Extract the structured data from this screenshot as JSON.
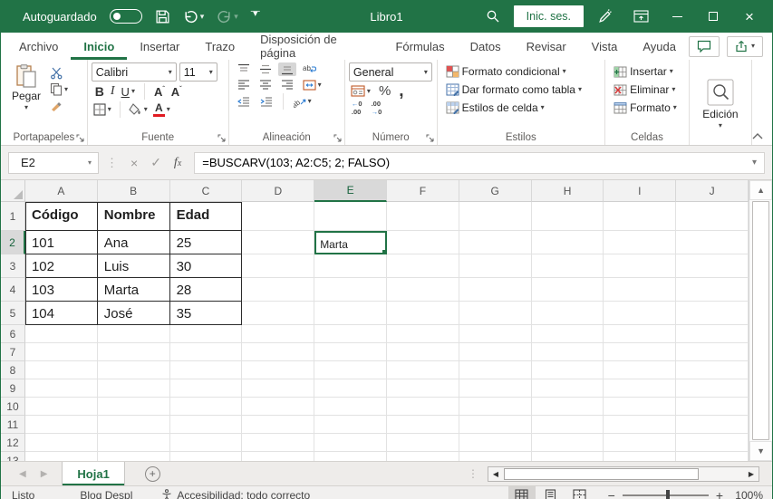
{
  "window": {
    "title": "Libro1",
    "autosave_label": "Autoguardado",
    "signin_label": "Inic. ses."
  },
  "ribbon_tabs": {
    "items": [
      "Archivo",
      "Inicio",
      "Insertar",
      "Trazo",
      "Disposición de página",
      "Fórmulas",
      "Datos",
      "Revisar",
      "Vista",
      "Ayuda"
    ],
    "active": "Inicio"
  },
  "ribbon": {
    "clipboard": {
      "label": "Portapapeles",
      "paste": "Pegar"
    },
    "font": {
      "label": "Fuente",
      "family": "Calibri",
      "size": "11"
    },
    "alignment": {
      "label": "Alineación"
    },
    "number": {
      "label": "Número",
      "format": "General"
    },
    "styles": {
      "label": "Estilos",
      "conditional": "Formato condicional",
      "format_table": "Dar formato como tabla",
      "cell_styles": "Estilos de celda"
    },
    "cells": {
      "label": "Celdas",
      "insert": "Insertar",
      "delete": "Eliminar",
      "format": "Formato"
    },
    "editing": {
      "label": "Edición"
    }
  },
  "formula_bar": {
    "name_box": "E2",
    "formula": "=BUSCARV(103; A2:C5; 2; FALSO)"
  },
  "grid": {
    "columns": [
      "A",
      "B",
      "C",
      "D",
      "E",
      "F",
      "G",
      "H",
      "I",
      "J"
    ],
    "row_count": 13,
    "selected_cell": "E2",
    "selected_col": "E",
    "selected_row": 2,
    "cells": {
      "A1": "Código",
      "B1": "Nombre",
      "C1": "Edad",
      "A2": "101",
      "B2": "Ana",
      "C2": "25",
      "A3": "102",
      "B3": "Luis",
      "C3": "30",
      "A4": "103",
      "B4": "Marta",
      "C4": "28",
      "A5": "104",
      "B5": "José",
      "C5": "35",
      "E2": "Marta"
    },
    "table_range": {
      "cols": [
        "A",
        "B",
        "C"
      ],
      "first_row": 1,
      "last_row": 5
    }
  },
  "sheet_bar": {
    "active_tab": "Hoja1"
  },
  "status_bar": {
    "mode": "Listo",
    "scroll_lock": "Bloq Despl",
    "accessibility": "Accesibilidad: todo correcto",
    "zoom_level": "100%"
  },
  "colors": {
    "accent": "#217346",
    "font_color_swatch": "#e11b22"
  }
}
